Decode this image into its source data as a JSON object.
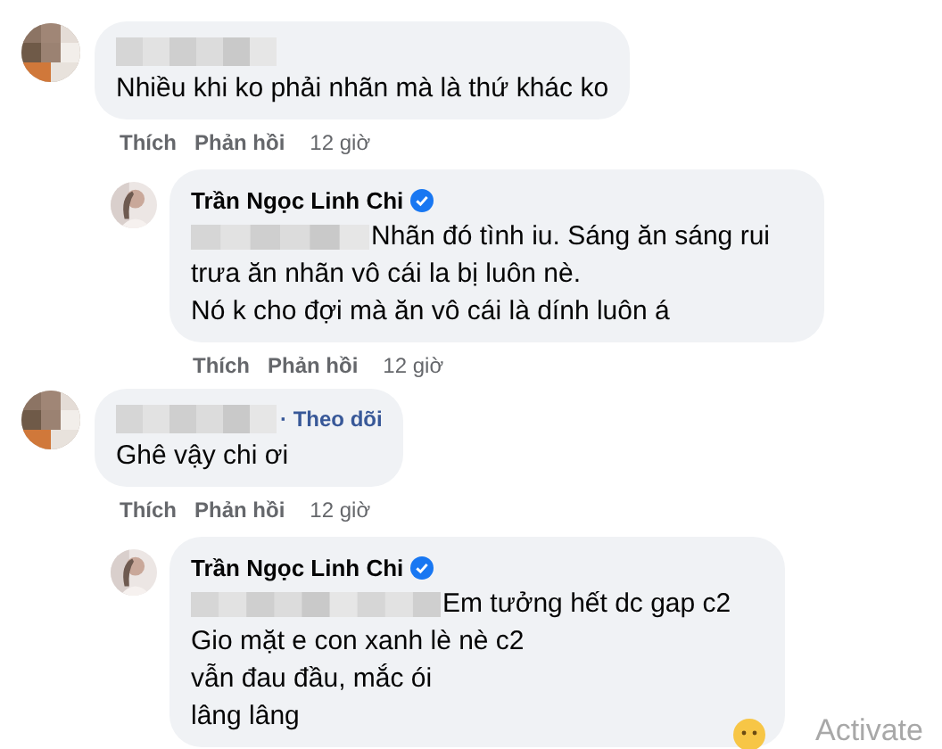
{
  "comments": [
    {
      "author": {
        "kind": "blurred"
      },
      "lines": [
        "Nhiều khi ko phải nhãn mà là thứ khác ko"
      ],
      "actions": {
        "like": "Thích",
        "reply": "Phản hồi",
        "time": "12 giờ"
      },
      "replies": [
        {
          "author": {
            "kind": "name",
            "text": "Trần Ngọc Linh Chi",
            "verified": true
          },
          "mention_blurred": true,
          "lines": [
            "Nhãn đó tình iu. Sáng ăn sáng rui",
            "trưa ăn nhãn vô cái la bị luôn nè.",
            "Nó k cho đợi mà ăn vô cái là dính luôn á"
          ],
          "actions": {
            "like": "Thích",
            "reply": "Phản hồi",
            "time": "12 giờ"
          }
        }
      ]
    },
    {
      "author": {
        "kind": "blurred",
        "follow": "· Theo dõi"
      },
      "lines": [
        "Ghê vậy chi ơi"
      ],
      "actions": {
        "like": "Thích",
        "reply": "Phản hồi",
        "time": "12 giờ"
      },
      "replies": [
        {
          "author": {
            "kind": "name",
            "text": "Trần Ngọc Linh Chi",
            "verified": true
          },
          "mention_blurred": true,
          "lines": [
            "Em tưởng hết dc gap c2",
            "Gio mặt e con xanh lè nè c2",
            "vẫn đau đầu, mắc ói",
            "lâng lâng"
          ]
        }
      ]
    }
  ],
  "overlay_text": "Activate"
}
